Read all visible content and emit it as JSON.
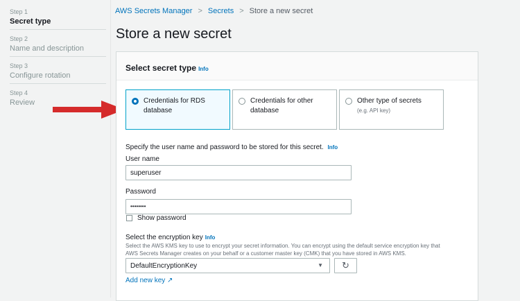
{
  "sidebar": {
    "steps": [
      {
        "number": "Step 1",
        "title": "Secret type",
        "active": true
      },
      {
        "number": "Step 2",
        "title": "Name and description"
      },
      {
        "number": "Step 3",
        "title": "Configure rotation"
      },
      {
        "number": "Step 4",
        "title": "Review"
      }
    ]
  },
  "breadcrumb": [
    "AWS Secrets Manager",
    "Secrets",
    "Store a new secret"
  ],
  "page_title": "Store a new secret",
  "panel": {
    "title": "Select secret type",
    "info": "Info",
    "options": [
      {
        "label": "Credentials for RDS database",
        "selected": true
      },
      {
        "label": "Credentials for other database"
      },
      {
        "label": "Other type of secrets",
        "sub": "(e.g. API key)"
      }
    ],
    "specify_text": "Specify the user name and password to be stored for this secret.",
    "specify_info": "Info",
    "username_label": "User name",
    "username_value": "superuser",
    "password_label": "Password",
    "password_value": "••••••••",
    "show_password": "Show password",
    "enc_label": "Select the encryption key",
    "enc_info": "Info",
    "enc_desc1": "Select the AWS KMS key to use to encrypt your secret information. You can encrypt using the default service encryption key that",
    "enc_desc2": "AWS Secrets Manager creates on your behalf or a customer master key (CMK) that you have stored in AWS KMS.",
    "enc_value": "DefaultEncryptionKey",
    "add_key": "Add new key"
  },
  "colors": {
    "accent": "#0073bb",
    "arrow": "#d52b2b"
  }
}
